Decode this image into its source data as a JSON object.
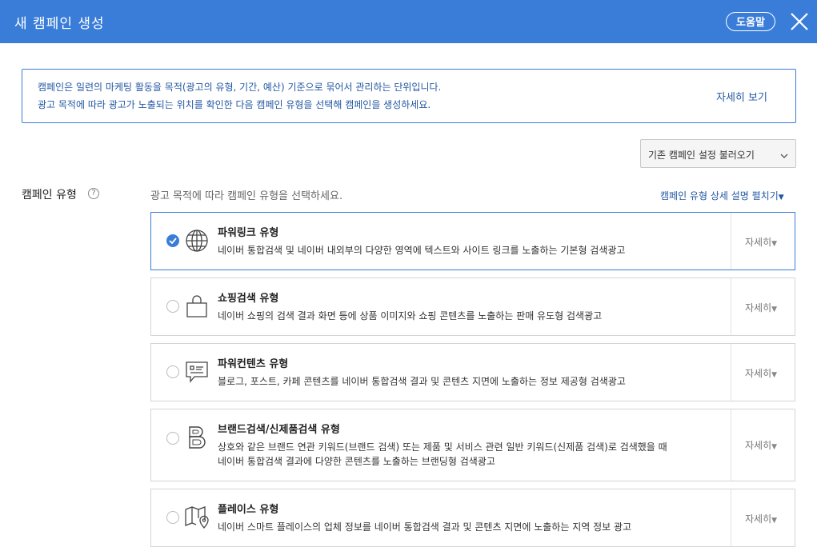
{
  "header": {
    "title": "새 캠페인 생성",
    "help_label": "도움말",
    "close_icon": "close-icon"
  },
  "info": {
    "line1": "캠페인은 일련의 마케팅 활동을 목적(광고의 유형, 기간, 예산) 기준으로 묶어서 관리하는 단위입니다.",
    "line2": "광고 목적에 따라 광고가 노출되는 위치를 확인한 다음 캠페인 유형을 선택해 캠페인을 생성하세요.",
    "more_label": "자세히 보기"
  },
  "load_settings": {
    "label": "기존 캠페인 설정 불러오기",
    "icon": "chevron-down-icon"
  },
  "campaign_type": {
    "label": "캠페인 유형",
    "help_icon": "?",
    "guide": "광고 목적에 따라 캠페인 유형을 선택하세요.",
    "detail_link": "캠페인 유형 상세 설명 펼치기",
    "detail_arrow": "▼",
    "more_arrow": "▼",
    "options": [
      {
        "name": "파워링크 유형",
        "desc1": "네이버 통합검색 및 네이버 내외부의 다양한 영역에 텍스트와 사이트 링크를 노출하는 기본형 검색광고",
        "desc2": "",
        "more": "자세히",
        "icon": "globe-icon",
        "selected": true
      },
      {
        "name": "쇼핑검색 유형",
        "desc1": "네이버 쇼핑의 검색 결과 화면 등에 상품 이미지와 쇼핑 콘텐츠를 노출하는 판매 유도형 검색광고",
        "desc2": "",
        "more": "자세히",
        "icon": "shopping-bag-icon",
        "selected": false
      },
      {
        "name": "파워컨텐츠 유형",
        "desc1": "블로그, 포스트, 카페 콘텐츠를 네이버 통합검색 결과 및 콘텐츠 지면에 노출하는 정보 제공형 검색광고",
        "desc2": "",
        "more": "자세히",
        "icon": "speech-bubble-icon",
        "selected": false
      },
      {
        "name": "브랜드검색/신제품검색 유형",
        "desc1": "상호와 같은 브랜드 연관 키워드(브랜드 검색) 또는 제품 및 서비스 관련 일반 키워드(신제품 검색)로 검색했을 때",
        "desc2": "네이버 통합검색 결과에 다양한 콘텐츠를 노출하는 브랜딩형 검색광고",
        "more": "자세히",
        "icon": "brand-b-icon",
        "selected": false
      },
      {
        "name": "플레이스 유형",
        "desc1": "네이버 스마트 플레이스의 업체 정보를 네이버 통합검색 결과 및 콘텐츠 지면에 노출하는 지역 정보 광고",
        "desc2": "",
        "more": "자세히",
        "icon": "map-pin-icon",
        "selected": false
      }
    ]
  },
  "colors": {
    "header_bg": "#3a7dd9",
    "link": "#2458a3",
    "selected_border": "#3a7dd9"
  }
}
